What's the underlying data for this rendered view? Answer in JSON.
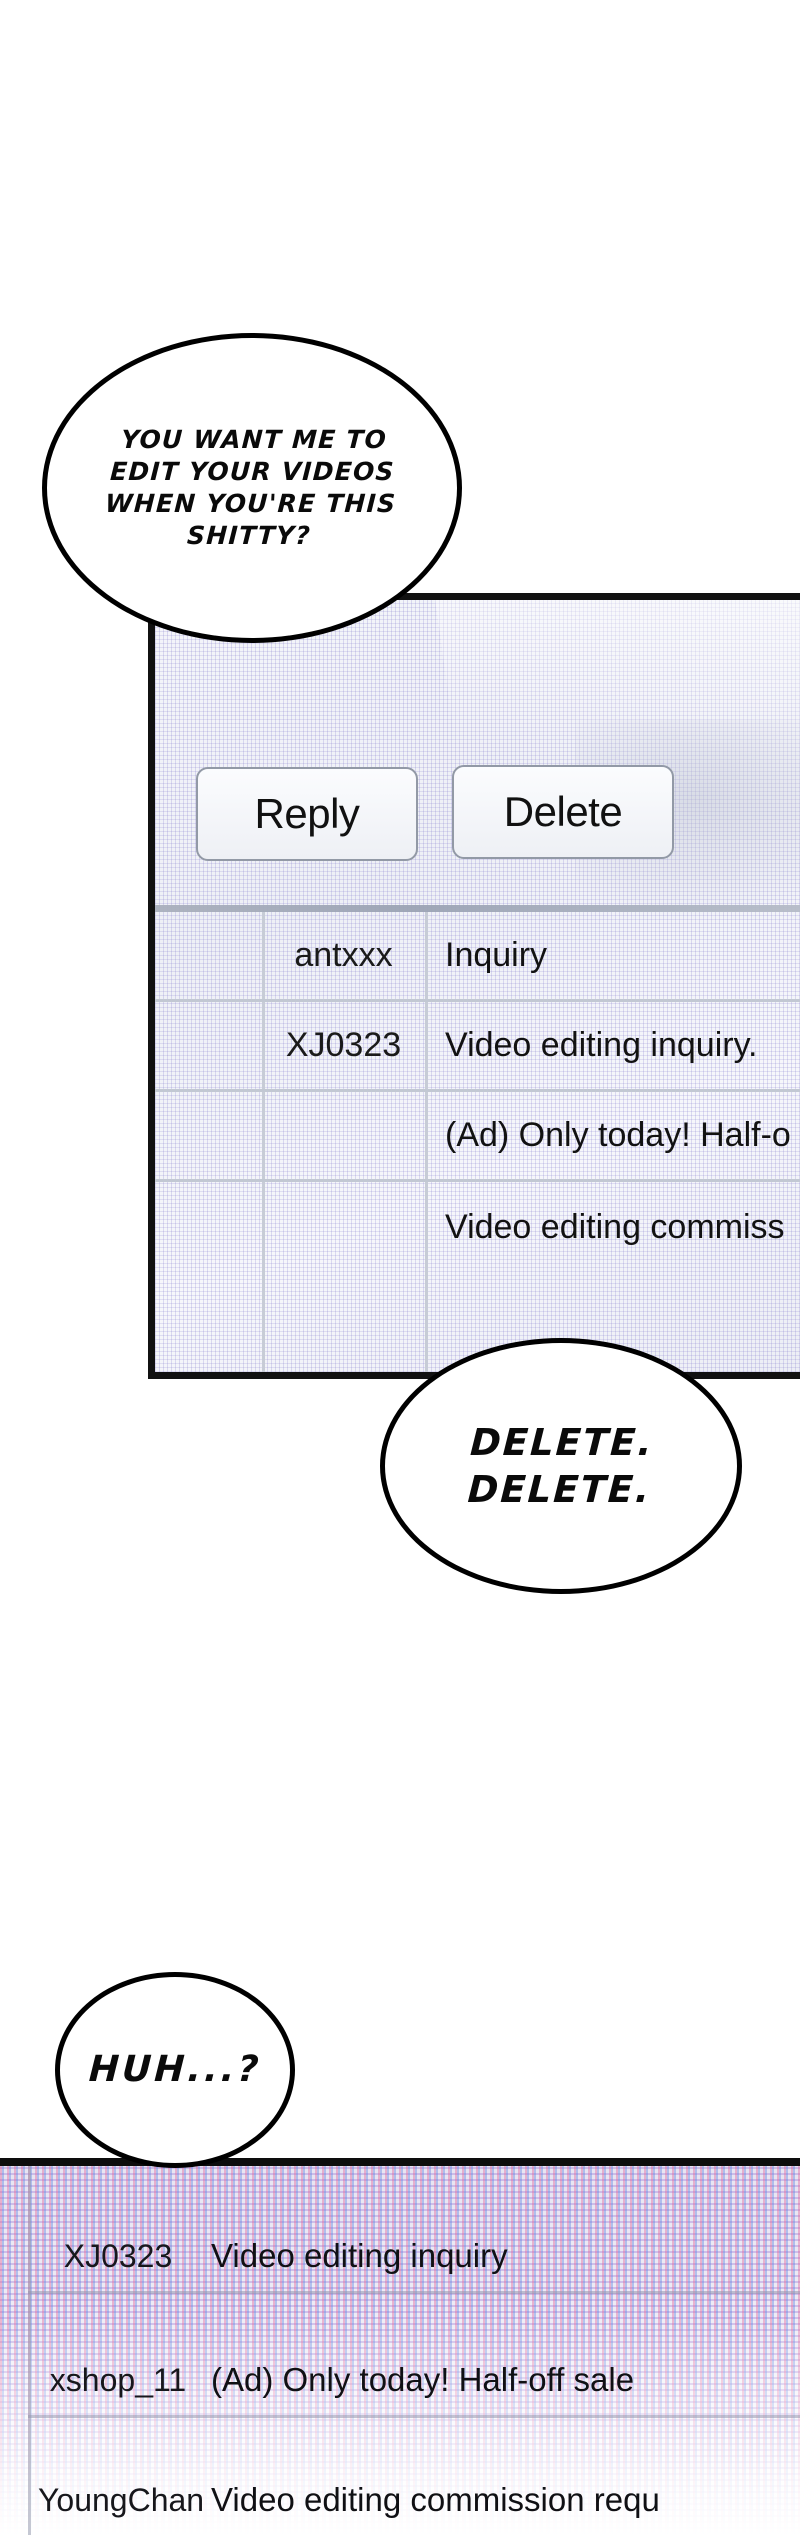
{
  "comic": {
    "bubbles": [
      {
        "id": "bubble-1",
        "name": "speech-bubble-insult",
        "lines": [
          "YOU WANT ME TO",
          "EDIT YOUR VIDEOS",
          "WHEN YOU'RE THIS",
          "SHITTY?"
        ],
        "text": "YOU WANT ME TO EDIT YOUR VIDEOS WHEN YOU'RE THIS SHITTY?"
      },
      {
        "id": "bubble-2",
        "name": "speech-bubble-delete",
        "lines": [
          "DELETE.",
          "DELETE."
        ],
        "text": "DELETE. DELETE."
      },
      {
        "id": "bubble-3",
        "name": "speech-bubble-huh",
        "lines": [
          "HUH...?"
        ],
        "text": "HUH...?"
      }
    ]
  },
  "panel_top": {
    "toolbar": {
      "reply_label": "Reply",
      "delete_label": "Delete"
    },
    "message_list": {
      "rows": [
        {
          "user": "antxxx",
          "title": "Inquiry"
        },
        {
          "user": "XJ0323",
          "title": "Video editing inquiry."
        },
        {
          "user": "",
          "title": "(Ad) Only today! Half-o"
        },
        {
          "user": "",
          "title": "Video editing commiss"
        }
      ]
    }
  },
  "panel_bottom": {
    "message_list": {
      "rows": [
        {
          "user": "XJ0323",
          "title": "Video editing inquiry"
        },
        {
          "user": "xshop_11",
          "title": "(Ad) Only today! Half-off sale"
        },
        {
          "user": "YoungChan",
          "title": "Video editing commission requ"
        }
      ]
    }
  },
  "colors": {
    "ink": "#000000",
    "panel_border": "#111111",
    "screen_bg": "#eef0f6",
    "moire_pink": "#e26096",
    "moire_blue": "#5a82e1",
    "button_border": "#9299a6"
  }
}
